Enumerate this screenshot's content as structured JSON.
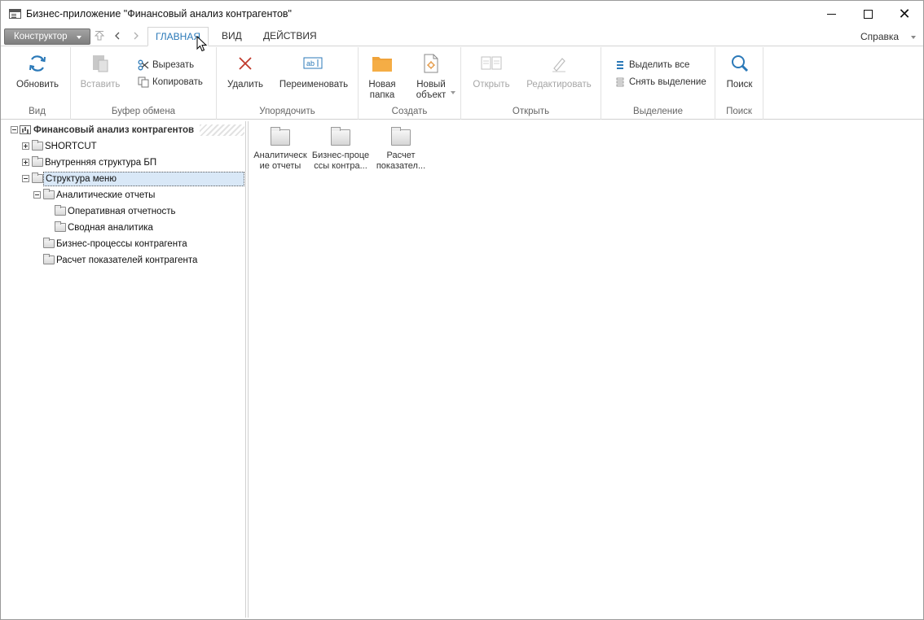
{
  "window": {
    "title": "Бизнес-приложение \"Финансовый анализ контрагентов\""
  },
  "tabrow": {
    "constructor_label": "Конструктор",
    "tabs": [
      {
        "label": "ГЛАВНАЯ",
        "active": true
      },
      {
        "label": "ВИД",
        "active": false
      },
      {
        "label": "ДЕЙСТВИЯ",
        "active": false
      }
    ],
    "help_label": "Справка"
  },
  "ribbon": {
    "groups": {
      "view": {
        "label": "Вид",
        "refresh": "Обновить"
      },
      "clipboard": {
        "label": "Буфер обмена",
        "paste": "Вставить",
        "cut": "Вырезать",
        "copy": "Копировать"
      },
      "organize": {
        "label": "Упорядочить",
        "delete": "Удалить",
        "rename": "Переименовать"
      },
      "create": {
        "label": "Создать",
        "new_folder_line1": "Новая",
        "new_folder_line2": "папка",
        "new_object_line1": "Новый",
        "new_object_line2": "объект"
      },
      "open": {
        "label": "Открыть",
        "open": "Открыть",
        "edit": "Редактировать"
      },
      "selection": {
        "label": "Выделение",
        "select_all": "Выделить все",
        "deselect": "Снять выделение"
      },
      "search": {
        "label": "Поиск",
        "search": "Поиск"
      }
    },
    "accent_color": "#2b79b8",
    "new_folder_color": "#f0a33a",
    "delete_color": "#c0392b"
  },
  "tree": {
    "root": "Финансовый анализ контрагентов",
    "items": [
      {
        "label": "SHORTCUT"
      },
      {
        "label": "Внутренняя структура БП"
      },
      {
        "label": "Структура меню"
      },
      {
        "label": "Аналитические отчеты"
      },
      {
        "label": "Оперативная отчетность"
      },
      {
        "label": "Сводная аналитика"
      },
      {
        "label": "Бизнес-процессы контрагента"
      },
      {
        "label": "Расчет показателей контрагента"
      }
    ]
  },
  "content": {
    "tiles": [
      {
        "line1": "Аналитическ",
        "line2": "ие отчеты"
      },
      {
        "line1": "Бизнес-проце",
        "line2": "ссы контра..."
      },
      {
        "line1": "Расчет",
        "line2": "показател..."
      }
    ]
  }
}
